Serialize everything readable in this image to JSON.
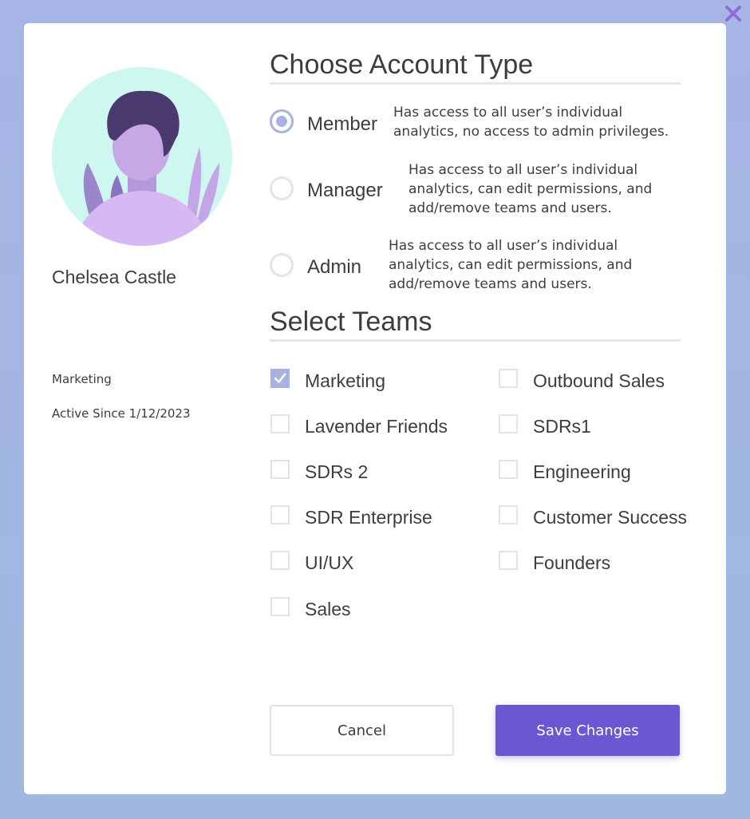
{
  "user": {
    "name": "Chelsea Castle",
    "team": "Marketing",
    "active_since": "Active Since 1/12/2023"
  },
  "account_type": {
    "title": "Choose Account Type",
    "options": [
      {
        "label": "Member",
        "description": "Has access to all user’s individual\nanalytics, no access to admin privileges.",
        "selected": true
      },
      {
        "label": "Manager",
        "description": "Has access to all user’s individual\nanalytics, can edit permissions, and\nadd/remove teams and users.",
        "selected": false
      },
      {
        "label": "Admin",
        "description": "Has access to all user’s individual\nanalytics, can edit permissions, and\nadd/remove teams and users.",
        "selected": false
      }
    ]
  },
  "teams": {
    "title": "Select Teams",
    "items": [
      {
        "label": "Marketing",
        "checked": true
      },
      {
        "label": "Outbound Sales",
        "checked": false
      },
      {
        "label": "Lavender Friends",
        "checked": false
      },
      {
        "label": "SDRs1",
        "checked": false
      },
      {
        "label": "SDRs 2",
        "checked": false
      },
      {
        "label": "Engineering",
        "checked": false
      },
      {
        "label": "SDR Enterprise",
        "checked": false
      },
      {
        "label": "Customer Success",
        "checked": false
      },
      {
        "label": "UI/UX",
        "checked": false
      },
      {
        "label": "Founders",
        "checked": false
      },
      {
        "label": "Sales",
        "checked": false
      }
    ]
  },
  "buttons": {
    "cancel": "Cancel",
    "save": "Save Changes"
  },
  "icons": {
    "close": "close-icon",
    "avatar": "person-avatar-icon",
    "check": "check-icon"
  },
  "colors": {
    "accent": "#6a57d2",
    "selection": "#a7b2e3",
    "close": "#8f6ed6",
    "avatar_bg": "#cdf7ef",
    "avatar_hair": "#4a3a6e",
    "avatar_skin": "#c7a8e6",
    "avatar_shirt": "#d6b8f5"
  }
}
